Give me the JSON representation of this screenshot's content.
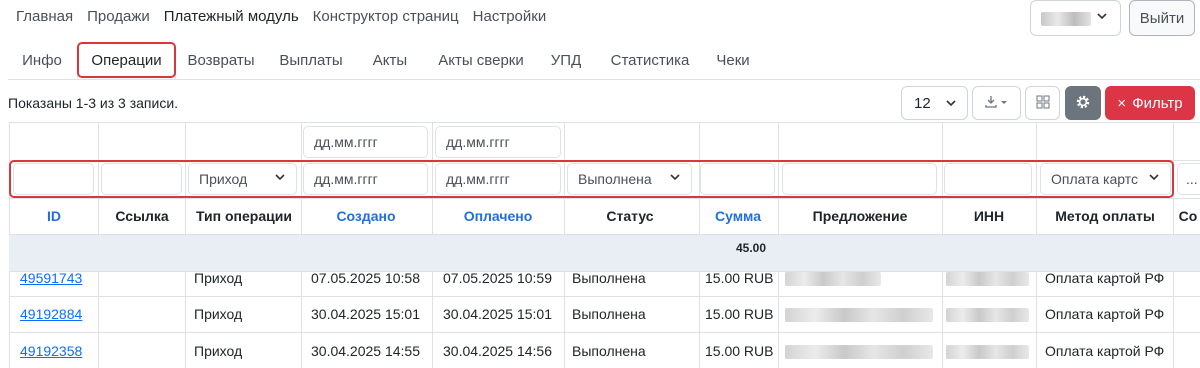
{
  "nav": {
    "items": [
      "Главная",
      "Продажи",
      "Платежный модуль",
      "Конструктор страниц",
      "Настройки"
    ],
    "logout_label": "Выйти"
  },
  "tabs": [
    "Инфо",
    "Операции",
    "Возвраты",
    "Выплаты",
    "Акты",
    "Акты сверки",
    "УПД",
    "Статистика",
    "Чеки"
  ],
  "toolbar": {
    "summary": "Показаны 1-3 из 3 записи.",
    "page_size": "12",
    "filter_label": "Фильтр",
    "filter_icon": "×"
  },
  "filters": {
    "date_placeholder": "дд.мм.гггг",
    "operation_type": "Приход",
    "status": "Выполнена",
    "payment_method": "Оплата картс",
    "more": "..."
  },
  "columns": [
    "ID",
    "Ссылка",
    "Тип операции",
    "Создано",
    "Оплачено",
    "Статус",
    "Сумма",
    "Предложение",
    "ИНН",
    "Метод оплаты",
    "Со"
  ],
  "total": "45.00",
  "rows": [
    {
      "id": "49591743",
      "type": "Приход",
      "created": "07.05.2025 10:58",
      "paid": "07.05.2025 10:59",
      "status": "Выполнена",
      "sum": "15.00 RUB",
      "method": "Оплата картой РФ"
    },
    {
      "id": "49192884",
      "type": "Приход",
      "created": "30.04.2025 15:01",
      "paid": "30.04.2025 15:01",
      "status": "Выполнена",
      "sum": "15.00 RUB",
      "method": "Оплата картой РФ"
    },
    {
      "id": "49192358",
      "type": "Приход",
      "created": "30.04.2025 14:55",
      "paid": "30.04.2025 14:56",
      "status": "Выполнена",
      "sum": "15.00 RUB",
      "method": "Оплата картой РФ"
    }
  ],
  "colors": {
    "accent": "#1f6fe0",
    "danger": "#dc3545",
    "highlight": "#d9373c"
  }
}
